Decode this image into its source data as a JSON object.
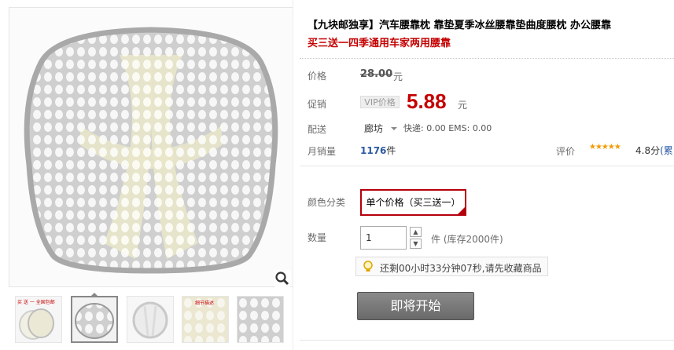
{
  "product": {
    "title": "【九块邮独享】汽车腰靠枕 靠垫夏季冰丝腰靠垫曲度腰枕 办公腰靠",
    "subtitle": "买三送一四季通用车家两用腰靠"
  },
  "price": {
    "label": "价格",
    "original": "28.00",
    "unit": "元"
  },
  "promo": {
    "label": "促销",
    "vip_tag": "VIP价格",
    "price": "5.88",
    "unit": "元"
  },
  "delivery": {
    "label": "配送",
    "location": "廊坊",
    "shipping": "快递: 0.00 EMS: 0.00"
  },
  "sales": {
    "label": "月销量",
    "count": "1176",
    "unit": "件"
  },
  "rating": {
    "label": "评价",
    "stars": "★★★★★",
    "score": "4.8分",
    "extra": "(累"
  },
  "sku": {
    "label": "颜色分类",
    "option": "单个价格（买三送一）"
  },
  "quantity": {
    "label": "数量",
    "value": "1",
    "up": "▲",
    "down": "▼",
    "stock": "件 (库存2000件)"
  },
  "timer": {
    "text": "还剩00小时33分钟07秒,请先收藏商品"
  },
  "buy_button": {
    "label": "即将开始"
  },
  "thumbnail_badge": {
    "text": "买 送 一 全国包邮"
  },
  "thumbnail_watermark": {
    "text": "细节描述"
  },
  "colors": {
    "accent_red": "#c40000",
    "link_blue": "#2b5aa3",
    "star_orange": "#f39b00"
  }
}
